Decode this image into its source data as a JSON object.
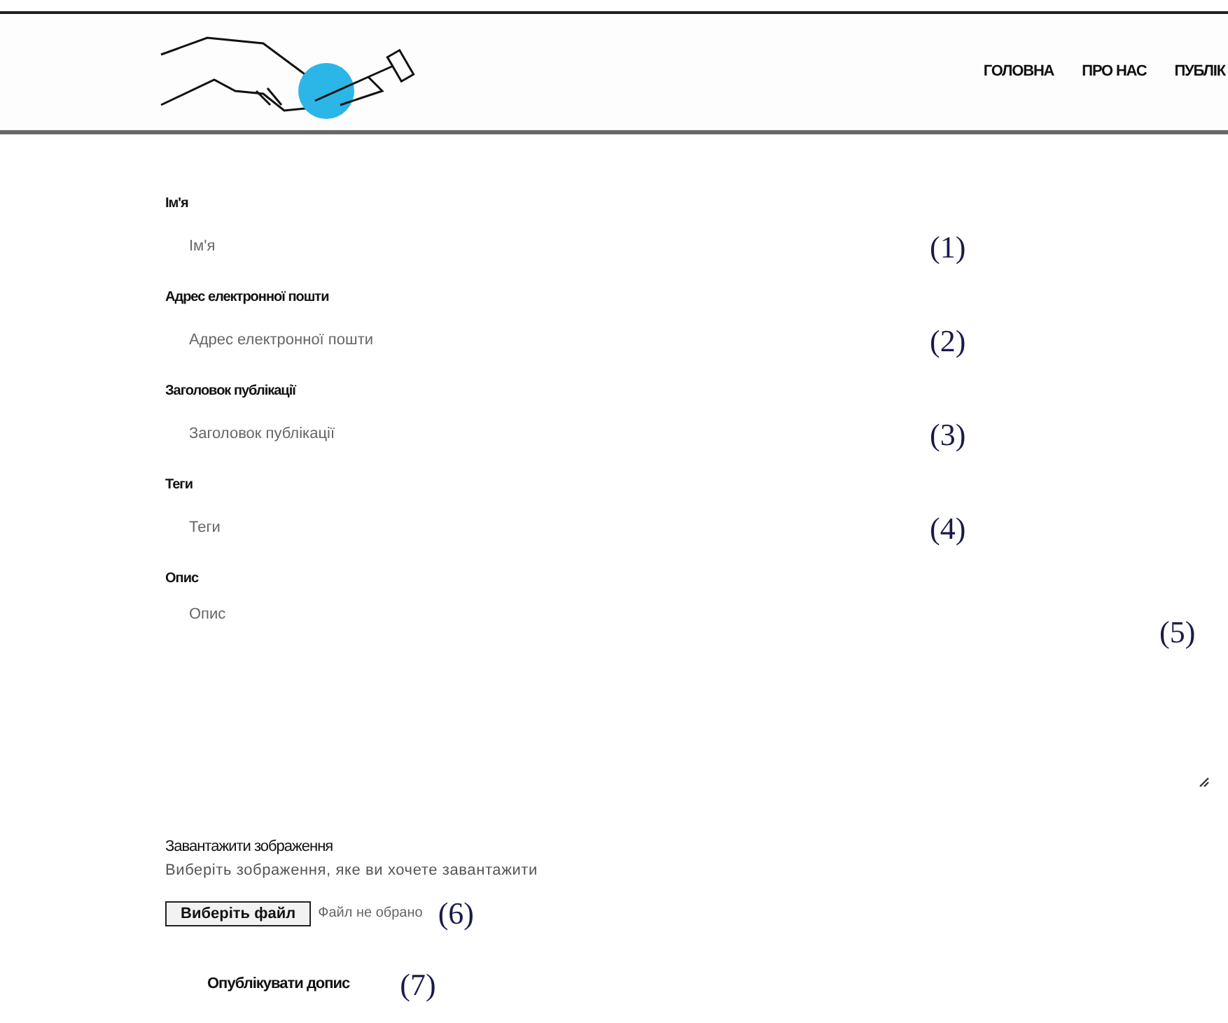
{
  "header": {
    "nav": [
      {
        "label": "ГОЛОВНА"
      },
      {
        "label": "ПРО НАС"
      },
      {
        "label": "ПУБЛІК"
      }
    ]
  },
  "form": {
    "fields": [
      {
        "kind": "input",
        "label": "Ім'я",
        "placeholder": "Ім'я",
        "annotation": "(1)"
      },
      {
        "kind": "input",
        "label": "Адрес електронної пошти",
        "placeholder": "Адрес електронної пошти",
        "annotation": "(2)"
      },
      {
        "kind": "input",
        "label": "Заголовок публікації",
        "placeholder": "Заголовок публікації",
        "annotation": "(3)"
      },
      {
        "kind": "input",
        "label": "Теги",
        "placeholder": "Теги",
        "annotation": "(4)"
      },
      {
        "kind": "textarea",
        "label": "Опис",
        "placeholder": "Опис",
        "annotation": "(5)"
      }
    ],
    "upload": {
      "title": "Завантажити зображення",
      "hint": "Виберіть зображення, яке ви хочете завантажити",
      "button": "Виберіть файл",
      "status": "Файл не обрано",
      "annotation": "(6)"
    },
    "submit": {
      "label": "Опублікувати допис",
      "annotation": "(7)"
    }
  }
}
